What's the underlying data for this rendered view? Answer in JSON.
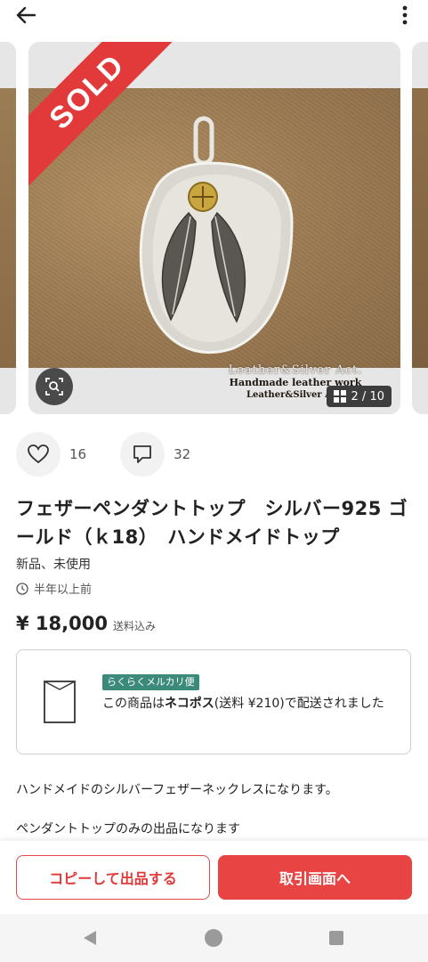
{
  "carousel": {
    "sold_label": "SOLD",
    "counter": "2 / 10",
    "watermark_line1": "Leather&Silver Act.",
    "watermark_line2": "Handmade leather work",
    "watermark_line3": "Leather&Silver Act."
  },
  "reactions": {
    "likes": "16",
    "comments": "32"
  },
  "item": {
    "title": "フェザーペンダントトップ　シルバー925 ゴールド（ｋ18）　ハンドメイドトップ",
    "condition": "新品、未使用",
    "posted": "半年以上前",
    "price": "¥ 18,000",
    "shipping_included": "送料込み"
  },
  "shipping": {
    "badge": "らくらくメルカリ便",
    "text_before": "この商品は",
    "method": "ネコポス",
    "text_after": "(送料 ¥210)で配送されました"
  },
  "description": {
    "line1": "ハンドメイドのシルバーフェザーネックレスになります。",
    "line2": "ペンダントトップのみの出品になります"
  },
  "actions": {
    "copy_label": "コピーして出品する",
    "trade_label": "取引画面へ"
  },
  "colors": {
    "accent": "#e84444",
    "sold": "#e23a3a",
    "badge": "#3b8a7a"
  }
}
